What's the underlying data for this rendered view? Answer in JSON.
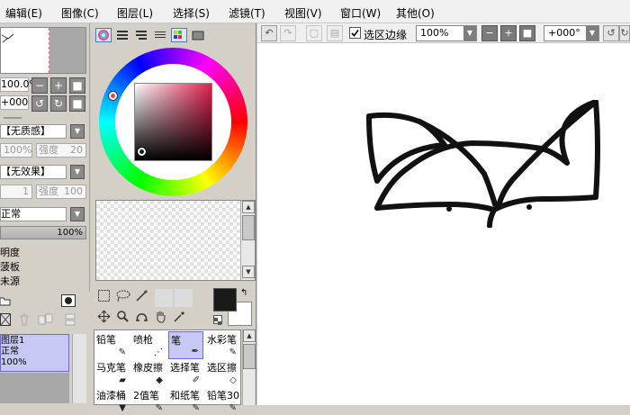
{
  "menubar": {
    "items": [
      "编辑(E)",
      "图像(C)",
      "图层(L)",
      "选择(S)",
      "滤镜(T)",
      "视图(V)",
      "窗口(W)",
      "其他(O)"
    ]
  },
  "left_panel": {
    "zoom_value": "100.0%",
    "angle_value": "+000",
    "texture_label": "【无质感】",
    "texture_percent": "100%",
    "texture_strength_label": "强度",
    "texture_strength_value": "20",
    "effect_label": "【无效果】",
    "effect_width_value": "1",
    "effect_strength_label": "强度",
    "effect_strength_value": "100",
    "blend_mode": "正常",
    "opacity_value": "100%",
    "check_items": [
      "明度",
      "菠板",
      "未源"
    ],
    "layer": {
      "name": "图层1",
      "mode": "正常",
      "opacity": "100%"
    }
  },
  "color_panel": {
    "accent": "#c85a7a"
  },
  "brush_panel": {
    "tools": [
      {
        "label": "铅笔",
        "icon": "pencil-icon"
      },
      {
        "label": "喷枪",
        "icon": "airbrush-icon"
      },
      {
        "label": "笔",
        "icon": "pen-icon"
      },
      {
        "label": "水彩笔",
        "icon": "watercolor-icon"
      },
      {
        "label": "马克笔",
        "icon": "marker-icon"
      },
      {
        "label": "橡皮擦",
        "icon": "eraser-icon"
      },
      {
        "label": "选择笔",
        "icon": "selpen-icon"
      },
      {
        "label": "选区擦",
        "icon": "selerase-icon"
      },
      {
        "label": "油漆桶",
        "icon": "bucket-icon"
      },
      {
        "label": "2值笔",
        "icon": "binary-pen-icon"
      },
      {
        "label": "和纸笔",
        "icon": "washi-pen-icon"
      },
      {
        "label": "铅笔30",
        "icon": "pencil30-icon"
      }
    ],
    "selected_index": 2
  },
  "canvas_toolbar": {
    "selection_edge_label": "选区边缘",
    "selection_edge_checked": true,
    "zoom_value": "100%",
    "rotation_value": "+000°"
  }
}
